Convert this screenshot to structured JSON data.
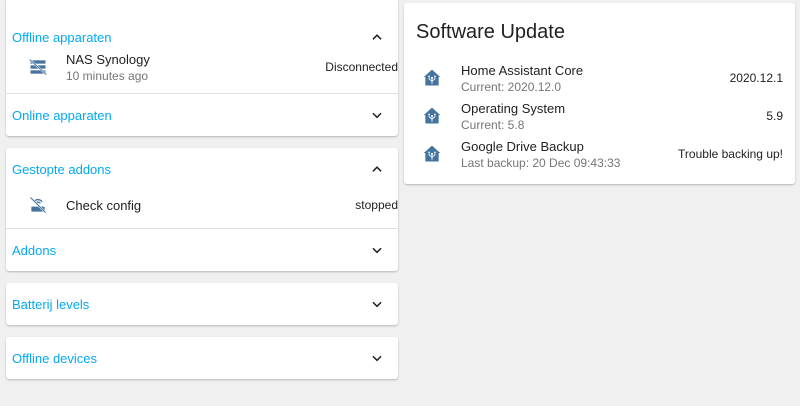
{
  "left": {
    "card1": {
      "section1": {
        "title": "Offline apparaten",
        "rows": [
          {
            "name": "NAS Synology",
            "secondary": "10 minutes ago",
            "state": "Disconnected",
            "icon": "nas-off-icon"
          }
        ]
      },
      "section2": {
        "title": "Online apparaten"
      }
    },
    "card2": {
      "section1": {
        "title": "Gestopte addons",
        "rows": [
          {
            "name": "Check config",
            "state": "stopped",
            "icon": "router-wireless-off-icon"
          }
        ]
      },
      "section2": {
        "title": "Addons"
      }
    },
    "card3": {
      "title": "Batterij levels"
    },
    "card4": {
      "title": "Offline devices"
    }
  },
  "right": {
    "title": "Software Update",
    "rows": [
      {
        "name": "Home Assistant Core",
        "secondary": "Current: 2020.12.0",
        "state": "2020.12.1",
        "icon": "home-assistant-icon"
      },
      {
        "name": "Operating System",
        "secondary": "Current: 5.8",
        "state": "5.9",
        "icon": "home-assistant-icon"
      },
      {
        "name": "Google Drive Backup",
        "secondary": "Last backup: 20 Dec 09:43:33",
        "state": "Trouble backing up!",
        "icon": "home-assistant-icon"
      }
    ]
  },
  "colors": {
    "accent": "#03a9f4",
    "icon": "#44739e",
    "background": "#f0f0f0"
  }
}
